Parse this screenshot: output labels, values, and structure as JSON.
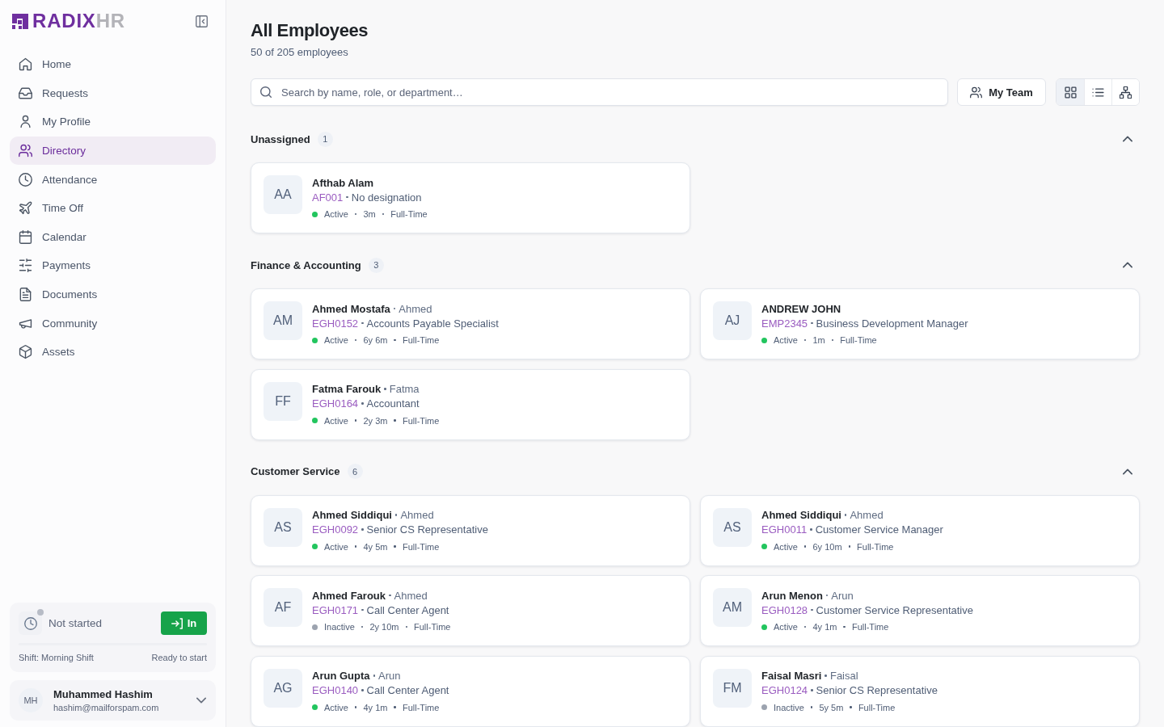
{
  "sidebar": {
    "logo": {
      "primary": "RADIX",
      "secondary": "HR"
    },
    "nav": [
      {
        "label": "Home",
        "selected": false
      },
      {
        "label": "Requests",
        "selected": false
      },
      {
        "label": "My Profile",
        "selected": false
      },
      {
        "label": "Directory",
        "selected": true
      },
      {
        "label": "Attendance",
        "selected": false
      },
      {
        "label": "Time Off",
        "selected": false
      },
      {
        "label": "Calendar",
        "selected": false
      },
      {
        "label": "Payments",
        "selected": false
      },
      {
        "label": "Documents",
        "selected": false
      },
      {
        "label": "Community",
        "selected": false
      },
      {
        "label": "Assets",
        "selected": false
      }
    ],
    "clock": {
      "status": "Not started",
      "button": "In",
      "shift": "Shift: Morning Shift",
      "hint": "Ready to start"
    },
    "user": {
      "initials": "MH",
      "name": "Muhammed Hashim",
      "email": "hashim@mailforspam.com"
    }
  },
  "header": {
    "title": "All Employees",
    "subtitle": "50 of 205 employees"
  },
  "toolbar": {
    "search": {
      "placeholder": "Search by name, role, or department…"
    },
    "my_team": "My Team",
    "views": [
      {
        "selected": true
      },
      {
        "selected": false
      },
      {
        "selected": false
      }
    ]
  },
  "groups": [
    {
      "name": "Unassigned",
      "count": "1",
      "expanded": true,
      "employees": [
        {
          "initials": "AA",
          "name": "Afthab Alam",
          "id": "AF001",
          "designation": "No designation",
          "status": "Active",
          "color": "#22c55e",
          "tenure": "3m",
          "type": "Full-Time"
        }
      ]
    },
    {
      "name": "Finance & Accounting",
      "count": "3",
      "expanded": true,
      "employees": [
        {
          "initials": "AM",
          "name": "Ahmed Mostafa",
          "nickname": "Ahmed",
          "id": "EGH0152",
          "designation": "Accounts Payable Specialist",
          "status": "Active",
          "color": "#22c55e",
          "tenure": "6y 6m",
          "type": "Full-Time"
        },
        {
          "initials": "AJ",
          "name": "ANDREW JOHN",
          "id": "EMP2345",
          "designation": "Business Development Manager",
          "status": "Active",
          "color": "#22c55e",
          "tenure": "1m",
          "type": "Full-Time"
        },
        {
          "initials": "FF",
          "name": "Fatma Farouk",
          "nickname": "Fatma",
          "id": "EGH0164",
          "designation": "Accountant",
          "status": "Active",
          "color": "#22c55e",
          "tenure": "2y 3m",
          "type": "Full-Time"
        }
      ]
    },
    {
      "name": "Customer Service",
      "count": "6",
      "expanded": true,
      "employees": [
        {
          "initials": "AS",
          "name": "Ahmed Siddiqui",
          "nickname": "Ahmed",
          "id": "EGH0092",
          "designation": "Senior CS Representative",
          "status": "Active",
          "color": "#22c55e",
          "tenure": "4y 5m",
          "type": "Full-Time"
        },
        {
          "initials": "AS",
          "name": "Ahmed Siddiqui",
          "nickname": "Ahmed",
          "id": "EGH0011",
          "designation": "Customer Service Manager",
          "status": "Active",
          "color": "#22c55e",
          "tenure": "6y 10m",
          "type": "Full-Time"
        },
        {
          "initials": "AF",
          "name": "Ahmed Farouk",
          "nickname": "Ahmed",
          "id": "EGH0171",
          "designation": "Call Center Agent",
          "status": "Inactive",
          "color": "#9ca3af",
          "tenure": "2y 10m",
          "type": "Full-Time"
        },
        {
          "initials": "AM",
          "name": "Arun Menon",
          "nickname": "Arun",
          "id": "EGH0128",
          "designation": "Customer Service Representative",
          "status": "Active",
          "color": "#22c55e",
          "tenure": "4y 1m",
          "type": "Full-Time"
        },
        {
          "initials": "AG",
          "name": "Arun Gupta",
          "nickname": "Arun",
          "id": "EGH0140",
          "designation": "Call Center Agent",
          "status": "Active",
          "color": "#22c55e",
          "tenure": "4y 1m",
          "type": "Full-Time"
        },
        {
          "initials": "FM",
          "name": "Faisal Masri",
          "nickname": "Faisal",
          "id": "EGH0124",
          "designation": "Senior CS Representative",
          "status": "Inactive",
          "color": "#9ca3af",
          "tenure": "5y 5m",
          "type": "Full-Time"
        }
      ]
    }
  ]
}
